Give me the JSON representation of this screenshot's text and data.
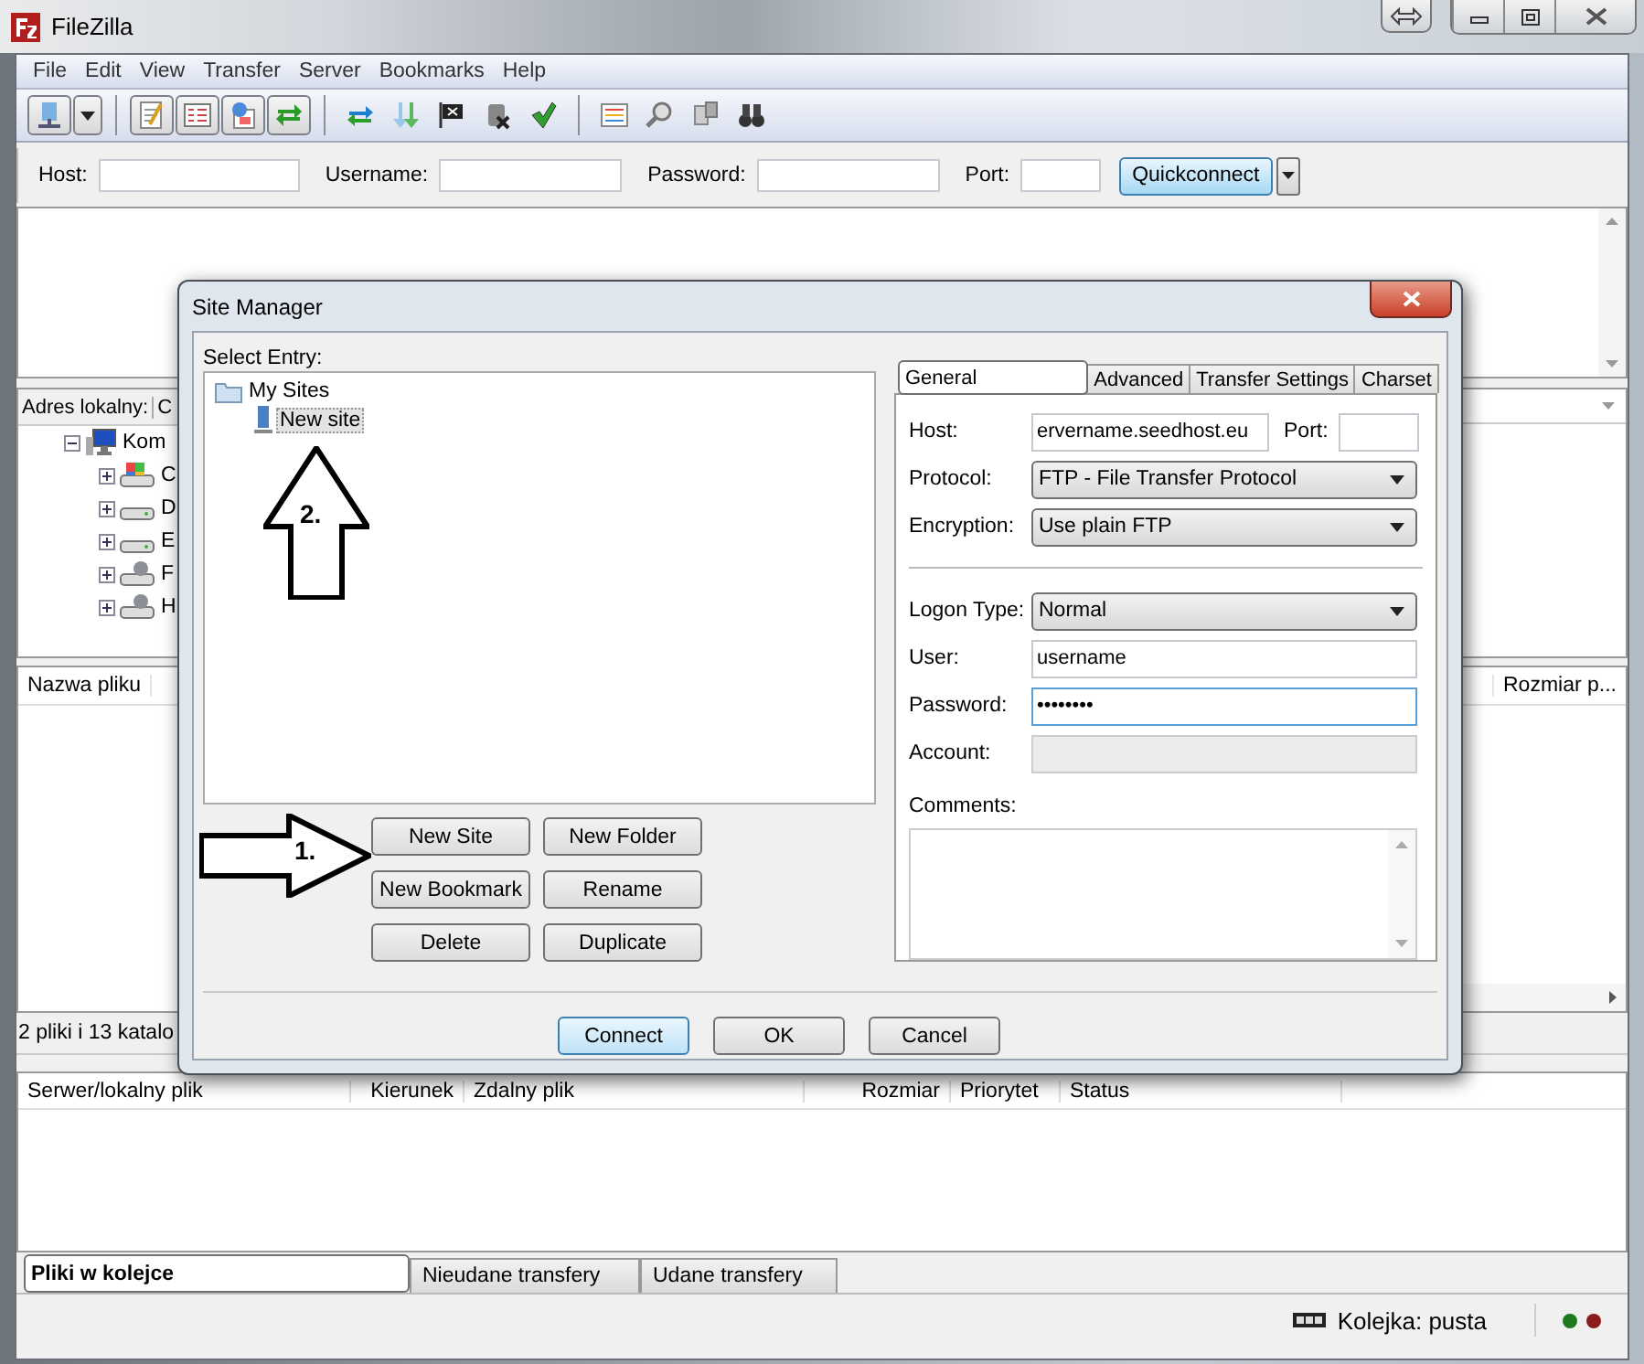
{
  "window": {
    "title": "FileZilla"
  },
  "menu": [
    "File",
    "Edit",
    "View",
    "Transfer",
    "Server",
    "Bookmarks",
    "Help"
  ],
  "quickconnect": {
    "fields": [
      {
        "label": "Host:"
      },
      {
        "label": "Username:"
      },
      {
        "label": "Password:"
      },
      {
        "label": "Port:"
      }
    ],
    "button": "Quickconnect"
  },
  "local_site": {
    "label": "Adres lokalny:",
    "value": "C",
    "tree": [
      {
        "label": "Kom",
        "expanded": true,
        "children": [
          {
            "label": "C",
            "kind": "system"
          },
          {
            "label": "D",
            "kind": "drive"
          },
          {
            "label": "E",
            "kind": "drive"
          },
          {
            "label": "F",
            "kind": "network"
          },
          {
            "label": "H",
            "kind": "network"
          }
        ]
      }
    ]
  },
  "local_files": {
    "columns": [
      "Nazwa pliku"
    ],
    "status": "2 pliki i 13 katalo"
  },
  "remote_files": {
    "columns": [
      "Rozmiar p..."
    ]
  },
  "queue": {
    "columns": [
      "Serwer/lokalny plik",
      "Kierunek",
      "Zdalny plik",
      "Rozmiar",
      "Priorytet",
      "Status"
    ],
    "tabs": [
      {
        "label": "Pliki w kolejce",
        "selected": true
      },
      {
        "label": "Nieudane transfery",
        "selected": false
      },
      {
        "label": "Udane transfery",
        "selected": false
      }
    ]
  },
  "status_bar": {
    "text": "Kolejka: pusta"
  },
  "site_manager": {
    "title": "Site Manager",
    "select_entry_label": "Select Entry:",
    "tree": [
      {
        "label": "My Sites",
        "expanded": true,
        "children": [
          {
            "label": "New site",
            "selected": true
          }
        ]
      }
    ],
    "entry_buttons": [
      "New Site",
      "New Folder",
      "New Bookmark",
      "Rename",
      "Delete",
      "Duplicate"
    ],
    "tabs": [
      {
        "label": "General",
        "selected": true
      },
      {
        "label": "Advanced",
        "selected": false
      },
      {
        "label": "Transfer Settings",
        "selected": false
      },
      {
        "label": "Charset",
        "selected": false
      }
    ],
    "general": {
      "host": {
        "label": "Host:",
        "value": "ervername.seedhost.eu"
      },
      "port": {
        "label": "Port:"
      },
      "protocol": {
        "label": "Protocol:",
        "value": "FTP - File Transfer Protocol"
      },
      "encryption": {
        "label": "Encryption:",
        "value": "Use plain FTP"
      },
      "logon_type": {
        "label": "Logon Type:",
        "value": "Normal"
      },
      "user": {
        "label": "User:",
        "value": "username"
      },
      "password": {
        "label": "Password:",
        "value": "••••••••"
      },
      "account": {
        "label": "Account:",
        "disabled": true
      },
      "comments": {
        "label": "Comments:"
      }
    },
    "buttons": [
      {
        "label": "Connect",
        "default": true
      },
      {
        "label": "OK",
        "default": false
      },
      {
        "label": "Cancel",
        "default": false
      }
    ]
  },
  "annotations": [
    {
      "label": "2.",
      "kind": "up-arrow"
    },
    {
      "label": "1.",
      "kind": "right-arrow"
    }
  ]
}
